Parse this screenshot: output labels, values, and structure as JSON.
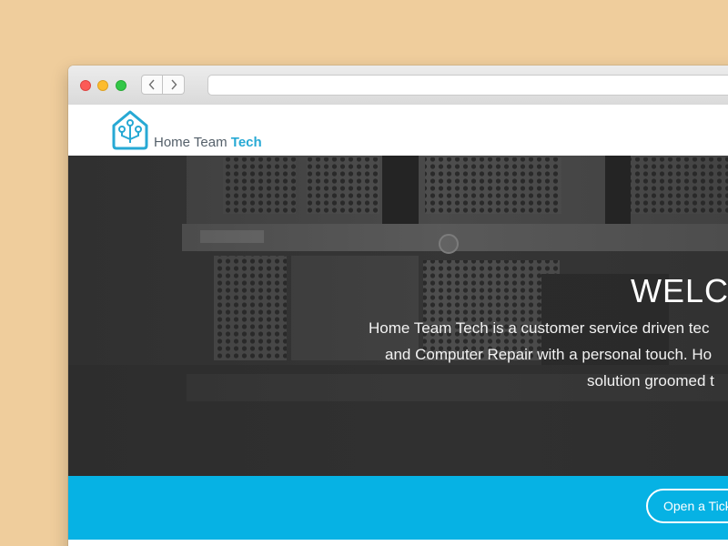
{
  "browser": {
    "address": ""
  },
  "site": {
    "logo_name_part1": "Home Team ",
    "logo_name_part2": "Tech",
    "accent_color": "#27a9d4",
    "cta_color": "#06b2e4"
  },
  "hero": {
    "title": "WELCO",
    "lines": [
      "Home Team Tech is a customer service driven tec",
      "and Computer Repair with a personal touch. Ho",
      "solution groomed t"
    ]
  },
  "cta": {
    "button_label": "Open a Tick"
  },
  "icons": {
    "back": "chevron-left-icon",
    "forward": "chevron-right-icon",
    "logo": "house-circuit-icon"
  }
}
